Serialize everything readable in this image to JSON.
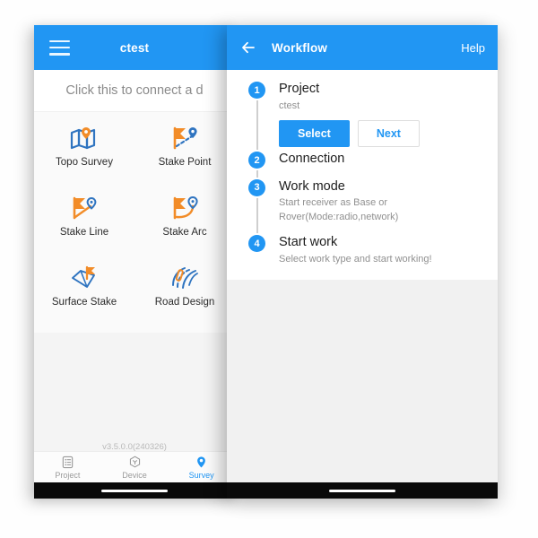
{
  "theme": {
    "accent": "#2196f3",
    "orange": "#f28c28",
    "blue_icon": "#2f74c0",
    "muted_text": "#8a8a8a",
    "page_bg": "#fefefe"
  },
  "left_phone": {
    "appbar": {
      "menu_icon": "hamburger-icon",
      "title": "ctest"
    },
    "connect_bar": {
      "text": "Click this to connect a d"
    },
    "tiles": [
      {
        "label": "Topo Survey",
        "icon": "map-pin-icon"
      },
      {
        "label": "Stake Point",
        "icon": "flag-dashed-pin-icon"
      },
      {
        "label": "Stake Line",
        "icon": "flag-line-pin-icon"
      },
      {
        "label": "Stake Arc",
        "icon": "flag-arc-pin-icon"
      },
      {
        "label": "Surface Stake",
        "icon": "surface-flag-icon"
      },
      {
        "label": "Road Design",
        "icon": "road-curves-icon"
      }
    ],
    "version": "v3.5.0.0(240326)",
    "tabs": [
      {
        "label": "Project",
        "icon": "list-document-icon",
        "active": false
      },
      {
        "label": "Device",
        "icon": "hexagon-antenna-icon",
        "active": false
      },
      {
        "label": "Survey",
        "icon": "location-pin-icon",
        "active": true
      }
    ]
  },
  "right_phone": {
    "appbar": {
      "back_icon": "back-arrow-icon",
      "title": "Workflow",
      "help_label": "Help"
    },
    "workflow": {
      "steps": [
        {
          "number": "1",
          "title": "Project",
          "subtitle": "ctest",
          "buttons": [
            {
              "label": "Select",
              "style": "primary"
            },
            {
              "label": "Next",
              "style": "outline"
            }
          ]
        },
        {
          "number": "2",
          "title": "Connection",
          "subtitle": ""
        },
        {
          "number": "3",
          "title": "Work mode",
          "subtitle": "Start receiver as Base or\nRover(Mode:radio,network)"
        },
        {
          "number": "4",
          "title": "Start work",
          "subtitle": "Select work type and start working!"
        }
      ]
    }
  }
}
